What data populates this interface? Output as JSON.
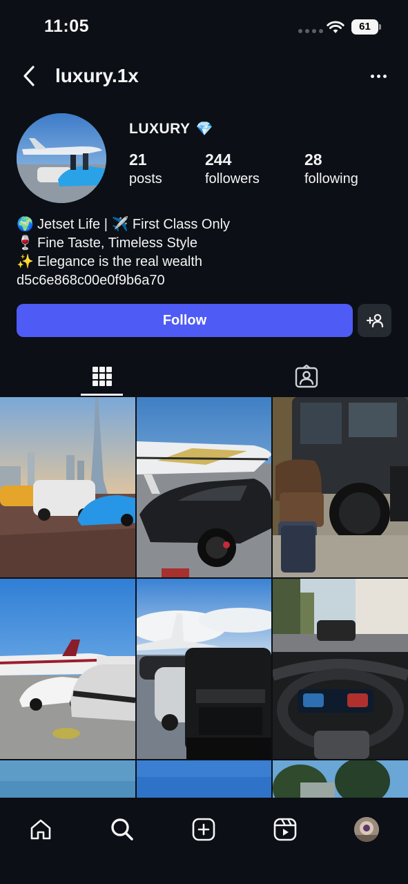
{
  "status_bar": {
    "time": "11:05",
    "battery_level": "61"
  },
  "header": {
    "username": "luxury.1x"
  },
  "profile": {
    "display_name": "LUXURY",
    "display_name_badge": "💎",
    "stats": {
      "posts_count": "21",
      "posts_label": "posts",
      "followers_count": "244",
      "followers_label": "followers",
      "following_count": "28",
      "following_label": "following"
    },
    "bio": [
      {
        "emoji": "🌍",
        "text": "Jetset Life | ✈️ First Class Only"
      },
      {
        "emoji": "🍷",
        "text": "Fine Taste, Timeless Style"
      },
      {
        "emoji": "✨",
        "text": "Elegance is the real wealth"
      }
    ],
    "bio_id": "d5c6e868c00e0f9b6a70"
  },
  "actions": {
    "follow_label": "Follow"
  },
  "tabs": [
    {
      "icon": "grid-icon",
      "selected": true
    },
    {
      "icon": "tagged-icon",
      "selected": false
    }
  ],
  "grid_posts": [
    {
      "subject": "Burj Khalifa skyline with supercars and G-Wagon"
    },
    {
      "subject": "Private jet and black Lamborghini Aventador"
    },
    {
      "subject": "Matte black G-Wagon with Louis Vuitton luggage"
    },
    {
      "subject": "Private jets and white Lamborghinis on tarmac"
    },
    {
      "subject": "Private jet, Rolls-Royce and black G-Wagon"
    },
    {
      "subject": "Car interior dashboard on palm-lined street"
    },
    {
      "subject": "Sky"
    },
    {
      "subject": "Sky"
    },
    {
      "subject": "Trees"
    }
  ],
  "bottom_nav": [
    "home-icon",
    "search-icon",
    "create-icon",
    "reels-icon",
    "profile-avatar"
  ],
  "colors": {
    "background": "#0c0f15",
    "accent": "#4f5bf5",
    "secondary_button": "#262a31",
    "text": "#f5f5f5"
  }
}
